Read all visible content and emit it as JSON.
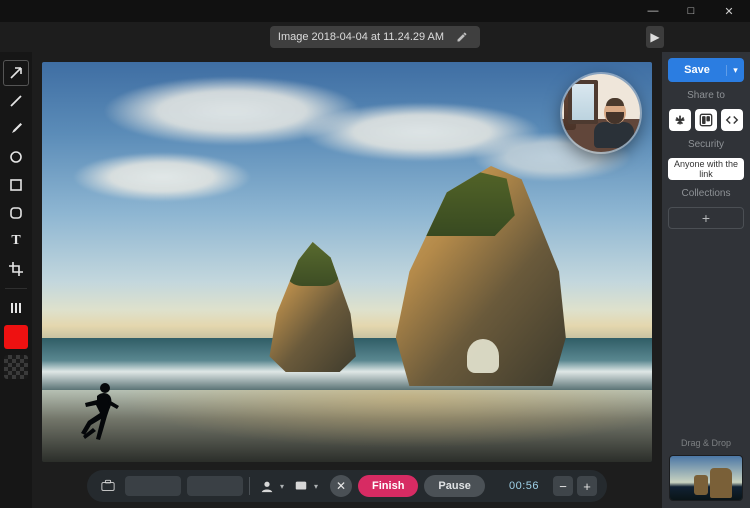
{
  "window": {
    "minimize": "—",
    "maximize": "□",
    "close": "✕"
  },
  "header": {
    "filename": "Image 2018-04-04 at 11.24.29 AM",
    "nav_right": "▶"
  },
  "tools": {
    "arrow": "arrow",
    "line": "line",
    "brush": "brush",
    "ellipse": "ellipse",
    "rect": "rect",
    "roundrect": "roundrect",
    "text": "T",
    "crop": "crop",
    "columns": "columns"
  },
  "recording": {
    "cancel": "✕",
    "finish": "Finish",
    "pause": "Pause",
    "timer": "00:56",
    "zoom_out": "−",
    "zoom_in": "+"
  },
  "right": {
    "save": "Save",
    "save_chevron": "▾",
    "share_label": "Share to",
    "security_label": "Security",
    "security_value": "Anyone with the link",
    "collections_label": "Collections",
    "add": "+",
    "drag_drop": "Drag & Drop"
  }
}
